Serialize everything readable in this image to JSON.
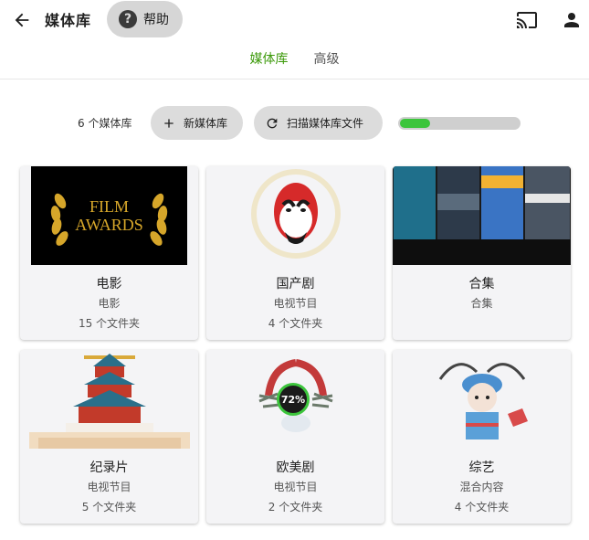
{
  "header": {
    "title": "媒体库",
    "help_label": "帮助",
    "icons": {
      "back": "arrow-back-icon",
      "help": "help-circle-icon",
      "cast": "cast-icon",
      "user": "account-icon"
    }
  },
  "tabs": [
    {
      "label": "媒体库",
      "active": true
    },
    {
      "label": "高级",
      "active": false
    }
  ],
  "toolbar": {
    "count_text": "6 个媒体库",
    "new_label": "新媒体库",
    "scan_label": "扫描媒体库文件",
    "scan_progress_fraction": 0.25
  },
  "libraries": [
    {
      "title": "电影",
      "subtitle": "电影",
      "count": "15 个文件夹",
      "image_text_line1": "FILM",
      "image_text_line2": "AWARDS"
    },
    {
      "title": "国产剧",
      "subtitle": "电视节目",
      "count": "4 个文件夹"
    },
    {
      "title": "合集",
      "subtitle": "合集",
      "count": ""
    },
    {
      "title": "纪录片",
      "subtitle": "电视节目",
      "count": "5 个文件夹"
    },
    {
      "title": "欧美剧",
      "subtitle": "电视节目",
      "count": "2 个文件夹",
      "progress_label": "72%"
    },
    {
      "title": "综艺",
      "subtitle": "混合内容",
      "count": "4 个文件夹"
    }
  ],
  "colors": {
    "accent": "#3d9a0b",
    "progress": "#3cc53c",
    "card_bg": "#f4f4f6",
    "button_bg": "#dcdcdc"
  }
}
